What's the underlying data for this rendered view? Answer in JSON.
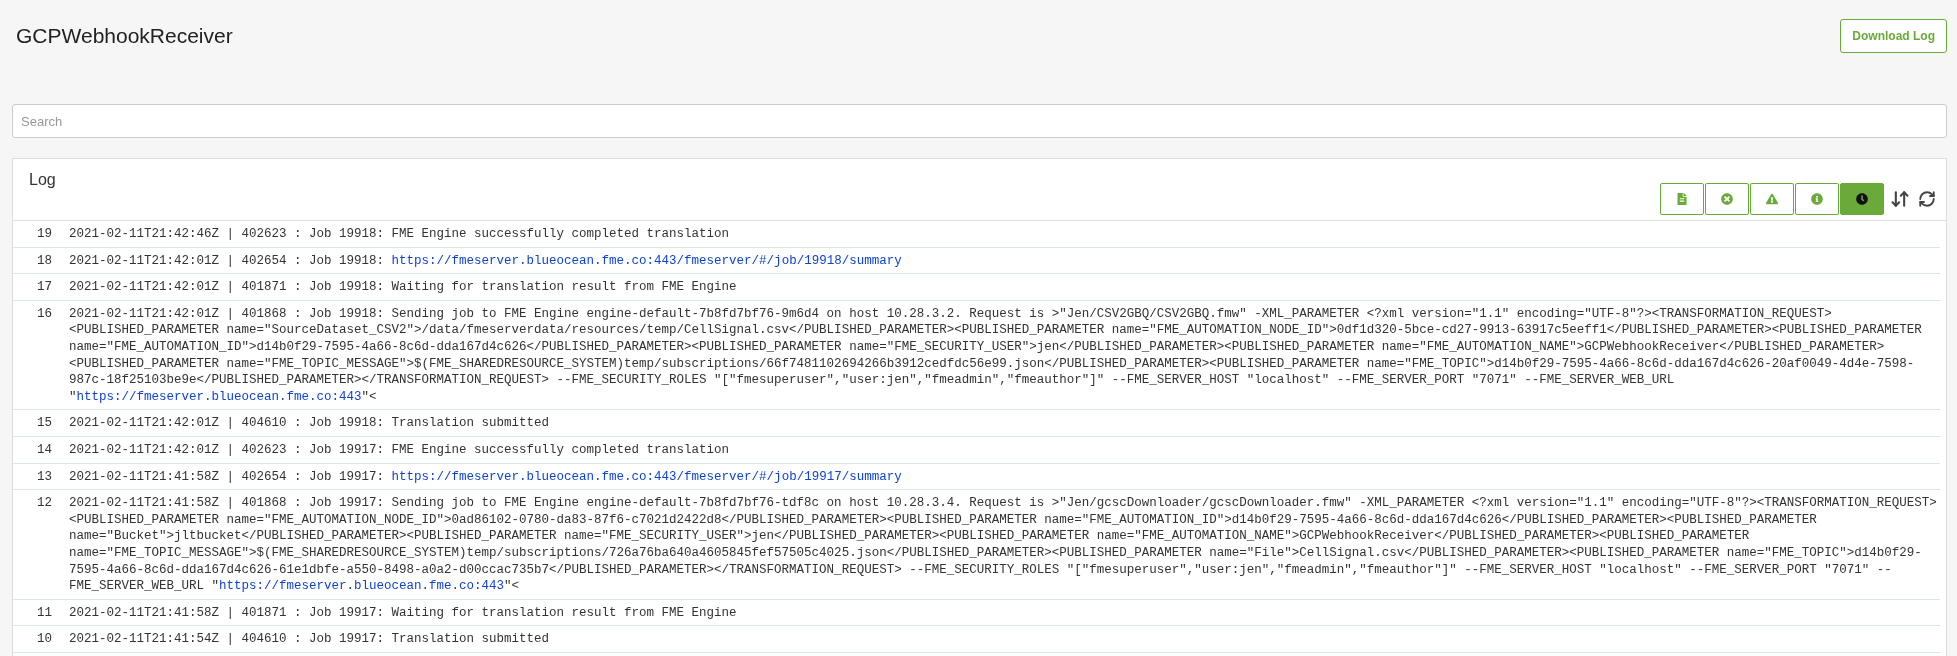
{
  "header": {
    "title": "GCPWebhookReceiver",
    "download_button": "Download Log"
  },
  "search": {
    "placeholder": "Search"
  },
  "log": {
    "title": "Log",
    "filters": [
      {
        "kind": "file",
        "selected": false
      },
      {
        "kind": "error",
        "selected": false
      },
      {
        "kind": "warning",
        "selected": false
      },
      {
        "kind": "info",
        "selected": false
      },
      {
        "kind": "time",
        "selected": true
      }
    ],
    "rows": [
      {
        "number": "19",
        "parts": [
          {
            "kind": "text",
            "text": "2021-02-11T21:42:46Z | 402623 : Job 19918: FME Engine successfully completed translation"
          }
        ]
      },
      {
        "number": "18",
        "parts": [
          {
            "kind": "text",
            "text": "2021-02-11T21:42:01Z | 402654 : Job 19918: "
          },
          {
            "kind": "link",
            "text": "https://fmeserver.blueocean.fme.co:443/fmeserver/#/job/19918/summary"
          }
        ]
      },
      {
        "number": "17",
        "parts": [
          {
            "kind": "text",
            "text": "2021-02-11T21:42:01Z | 401871 : Job 19918: Waiting for translation result from FME Engine"
          }
        ]
      },
      {
        "number": "16",
        "parts": [
          {
            "kind": "text",
            "text": "2021-02-11T21:42:01Z | 401868 : Job 19918: Sending job to FME Engine engine-default-7b8fd7bf76-9m6d4 on host 10.28.3.2. Request is >\"Jen/CSV2GBQ/CSV2GBQ.fmw\" -XML_PARAMETER <?xml version=\"1.1\" encoding=\"UTF-8\"?><TRANSFORMATION_REQUEST><PUBLISHED_PARAMETER name=\"SourceDataset_CSV2\">/data/fmeserverdata/resources/temp/CellSignal.csv</PUBLISHED_PARAMETER><PUBLISHED_PARAMETER name=\"FME_AUTOMATION_NODE_ID\">0df1d320-5bce-cd27-9913-63917c5eeff1</PUBLISHED_PARAMETER><PUBLISHED_PARAMETER name=\"FME_AUTOMATION_ID\">d14b0f29-7595-4a66-8c6d-dda167d4c626</PUBLISHED_PARAMETER><PUBLISHED_PARAMETER name=\"FME_SECURITY_USER\">jen</PUBLISHED_PARAMETER><PUBLISHED_PARAMETER name=\"FME_AUTOMATION_NAME\">GCPWebhookReceiver</PUBLISHED_PARAMETER><PUBLISHED_PARAMETER name=\"FME_TOPIC_MESSAGE\">$(FME_SHAREDRESOURCE_SYSTEM)temp/subscriptions/66f7481102694266b3912cedfdc56e99.json</PUBLISHED_PARAMETER><PUBLISHED_PARAMETER name=\"FME_TOPIC\">d14b0f29-7595-4a66-8c6d-dda167d4c626-20af0049-4d4e-7598-987c-18f25103be9e</PUBLISHED_PARAMETER></TRANSFORMATION_REQUEST> --FME_SECURITY_ROLES \"[\"fmesuperuser\",\"user:jen\",\"fmeadmin\",\"fmeauthor\"]\" --FME_SERVER_HOST \"localhost\" --FME_SERVER_PORT \"7071\" --FME_SERVER_WEB_URL \""
          },
          {
            "kind": "link",
            "text": "https://fmeserver.blueocean.fme.co:443"
          },
          {
            "kind": "text",
            "text": "\"<"
          }
        ]
      },
      {
        "number": "15",
        "parts": [
          {
            "kind": "text",
            "text": "2021-02-11T21:42:01Z | 404610 : Job 19918: Translation submitted"
          }
        ]
      },
      {
        "number": "14",
        "parts": [
          {
            "kind": "text",
            "text": "2021-02-11T21:42:01Z | 402623 : Job 19917: FME Engine successfully completed translation"
          }
        ]
      },
      {
        "number": "13",
        "parts": [
          {
            "kind": "text",
            "text": "2021-02-11T21:41:58Z | 402654 : Job 19917: "
          },
          {
            "kind": "link",
            "text": "https://fmeserver.blueocean.fme.co:443/fmeserver/#/job/19917/summary"
          }
        ]
      },
      {
        "number": "12",
        "parts": [
          {
            "kind": "text",
            "text": "2021-02-11T21:41:58Z | 401868 : Job 19917: Sending job to FME Engine engine-default-7b8fd7bf76-tdf8c on host 10.28.3.4. Request is >\"Jen/gcscDownloader/gcscDownloader.fmw\" -XML_PARAMETER <?xml version=\"1.1\" encoding=\"UTF-8\"?><TRANSFORMATION_REQUEST><PUBLISHED_PARAMETER name=\"FME_AUTOMATION_NODE_ID\">0ad86102-0780-da83-87f6-c7021d2422d8</PUBLISHED_PARAMETER><PUBLISHED_PARAMETER name=\"FME_AUTOMATION_ID\">d14b0f29-7595-4a66-8c6d-dda167d4c626</PUBLISHED_PARAMETER><PUBLISHED_PARAMETER name=\"Bucket\">jltbucket</PUBLISHED_PARAMETER><PUBLISHED_PARAMETER name=\"FME_SECURITY_USER\">jen</PUBLISHED_PARAMETER><PUBLISHED_PARAMETER name=\"FME_AUTOMATION_NAME\">GCPWebhookReceiver</PUBLISHED_PARAMETER><PUBLISHED_PARAMETER name=\"FME_TOPIC_MESSAGE\">$(FME_SHAREDRESOURCE_SYSTEM)temp/subscriptions/726a76ba640a4605845fef57505c4025.json</PUBLISHED_PARAMETER><PUBLISHED_PARAMETER name=\"File\">CellSignal.csv</PUBLISHED_PARAMETER><PUBLISHED_PARAMETER name=\"FME_TOPIC\">d14b0f29-7595-4a66-8c6d-dda167d4c626-61e1dbfe-a550-8498-a0a2-d00ccac735b7</PUBLISHED_PARAMETER></TRANSFORMATION_REQUEST> --FME_SECURITY_ROLES \"[\"fmesuperuser\",\"user:jen\",\"fmeadmin\",\"fmeauthor\"]\" --FME_SERVER_HOST \"localhost\" --FME_SERVER_PORT \"7071\" --FME_SERVER_WEB_URL \""
          },
          {
            "kind": "link",
            "text": "https://fmeserver.blueocean.fme.co:443"
          },
          {
            "kind": "text",
            "text": "\"<"
          }
        ]
      },
      {
        "number": "11",
        "parts": [
          {
            "kind": "text",
            "text": "2021-02-11T21:41:58Z | 401871 : Job 19917: Waiting for translation result from FME Engine"
          }
        ]
      },
      {
        "number": "10",
        "parts": [
          {
            "kind": "text",
            "text": "2021-02-11T21:41:54Z | 404610 : Job 19917: Translation submitted"
          }
        ]
      }
    ]
  }
}
